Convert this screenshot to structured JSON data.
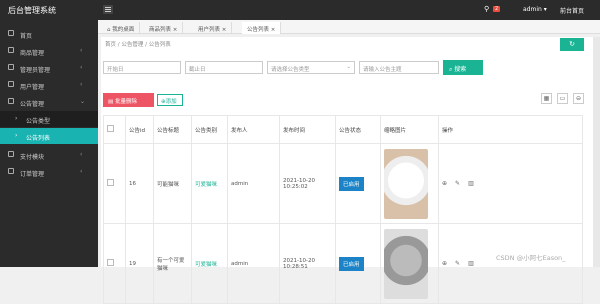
{
  "header": {
    "title": "后台管理系统",
    "notif_count": "2",
    "user": "admin",
    "home": "前台首页"
  },
  "sidebar": {
    "items": [
      {
        "label": "首页",
        "icon": "home-icon"
      },
      {
        "label": "商品管理",
        "icon": "box-icon"
      },
      {
        "label": "管理员管理",
        "icon": "admin-icon"
      },
      {
        "label": "用户管理",
        "icon": "user-icon"
      },
      {
        "label": "公告管理",
        "icon": "notice-icon"
      },
      {
        "label": "支付模块",
        "icon": "pay-icon"
      },
      {
        "label": "订单管理",
        "icon": "order-icon"
      }
    ],
    "subitems": [
      {
        "label": "公告类型"
      },
      {
        "label": "公告列表"
      }
    ]
  },
  "tabs": [
    {
      "label": "我的桌面"
    },
    {
      "label": "商品列表"
    },
    {
      "label": "用户列表"
    },
    {
      "label": "公告列表"
    }
  ],
  "breadcrumb": "首页 / 公告管理 / 公告列表",
  "filters": {
    "start": "开始日",
    "end": "截止日",
    "type": "请选择公告类型",
    "topic": "请输入公告主题",
    "search": "搜索"
  },
  "actions": {
    "delete": "批量删除",
    "add": "添加"
  },
  "table": {
    "headers": [
      "",
      "公告id",
      "公告标题",
      "公告类别",
      "发布人",
      "发布时间",
      "公告状态",
      "缩略图片",
      "操作"
    ],
    "rows": [
      {
        "id": "16",
        "title": "可能猫咪",
        "category": "可爱猫咪",
        "publisher": "admin",
        "time": "2021-10-20 10:25:02",
        "status": "已启用"
      },
      {
        "id": "19",
        "title": "有一个可爱猫咪",
        "category": "可爱猫咪",
        "publisher": "admin",
        "time": "2021-10-20 10:28:51",
        "status": "已启用"
      }
    ]
  },
  "watermark": "CSDN @小阿七Eason_"
}
